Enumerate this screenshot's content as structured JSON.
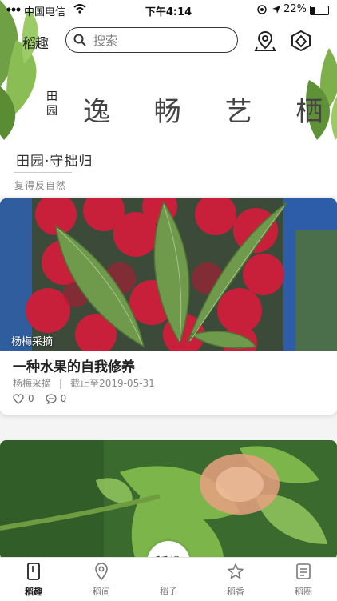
{
  "status_bar": {
    "carrier": "中国电信",
    "time": "下午4:14",
    "battery": "22%",
    "battery_level": 0.22
  },
  "header": {
    "logo_text": "稻趣",
    "search_placeholder": "搜索",
    "slogan_small": "田园",
    "slogan_big": "逸 畅 艺 栖 居"
  },
  "section": {
    "title": "田园·守拙归",
    "subtitle": "复得反自然"
  },
  "cards": [
    {
      "image_tag": "杨梅采摘",
      "title": "一种水果的自我修养",
      "category": "杨梅采摘",
      "separator": "|",
      "deadline": "截止至2019-05-31",
      "likes": "0",
      "comments": "0"
    }
  ],
  "tabbar": {
    "items": [
      {
        "label": "稻趣",
        "active": true
      },
      {
        "label": "稻间"
      },
      {
        "label": "稻子"
      },
      {
        "label": "稻香"
      },
      {
        "label": "稻圈"
      }
    ],
    "center_logo": "稻趣"
  },
  "colors": {
    "accent": "#222222",
    "inactive": "#777777",
    "berry": "#d0283a",
    "leaf": "#5e8f3c"
  }
}
